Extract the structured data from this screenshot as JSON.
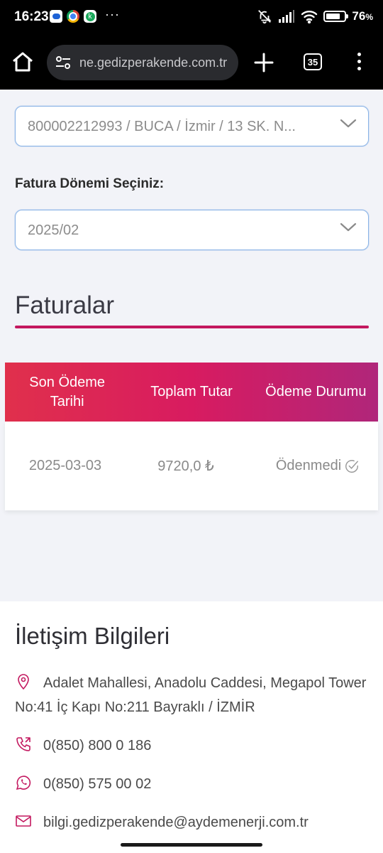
{
  "status_bar": {
    "time": "16:23",
    "notifications_more": "···",
    "battery_percent": "76",
    "battery_unit": "%"
  },
  "browser": {
    "url": "ne.gedizperakende.com.tr",
    "tab_count": "35"
  },
  "form": {
    "account_select_value": "800002212993 / BUCA / İzmir / 13 SK. N...",
    "period_label": "Fatura Dönemi Seçiniz:",
    "period_select_value": "2025/02"
  },
  "invoices": {
    "section_title": "Faturalar",
    "columns": [
      "Son Ödeme Tarihi",
      "Toplam Tutar",
      "Ödeme Durumu"
    ],
    "rows": [
      {
        "due_date": "2025-03-03",
        "total": "9720,0 ₺",
        "status": "Ödenmedi"
      }
    ]
  },
  "contact": {
    "title": "İletişim Bilgileri",
    "address": "Adalet Mahallesi, Anadolu Caddesi, Megapol Tower No:41 İç Kapı No:211 Bayraklı / İZMİR",
    "phone": "0(850) 800 0 186",
    "whatsapp": "0(850) 575 00 02",
    "email": "bilgi.gedizperakende@aydemenerji.com.tr"
  },
  "colors": {
    "accent": "#c3185f",
    "header_gradient_start": "#e0304c",
    "header_gradient_end": "#b0267a",
    "select_border": "#8ab3e6"
  }
}
